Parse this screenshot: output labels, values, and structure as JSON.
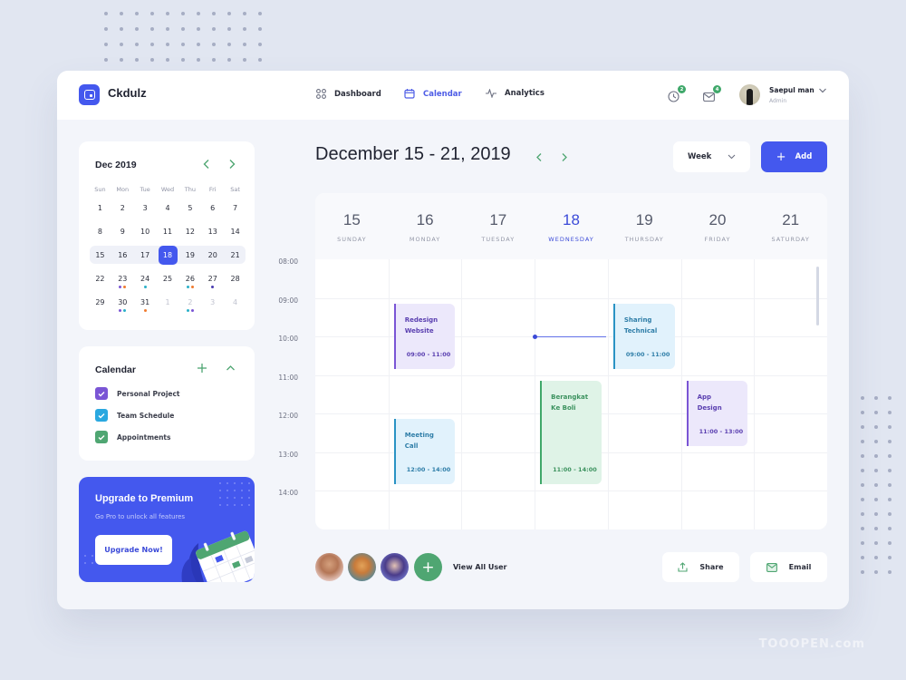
{
  "app": {
    "name": "Ckdulz"
  },
  "nav": [
    {
      "label": "Dashboard",
      "icon": "grid-icon",
      "active": false
    },
    {
      "label": "Calendar",
      "icon": "calendar-icon",
      "active": true
    },
    {
      "label": "Analytics",
      "icon": "activity-icon",
      "active": false
    }
  ],
  "header": {
    "notifications": {
      "icon": "clock-icon",
      "count": "2"
    },
    "messages": {
      "icon": "mail-icon",
      "count": "4"
    },
    "user": {
      "name": "Saepul man",
      "role": "Admin"
    }
  },
  "mini_calendar": {
    "title": "Dec 2019",
    "weekdays": [
      "Sun",
      "Mon",
      "Tue",
      "Wed",
      "Thu",
      "Fri",
      "Sat"
    ],
    "weeks": [
      [
        {
          "d": "1"
        },
        {
          "d": "2"
        },
        {
          "d": "3"
        },
        {
          "d": "4"
        },
        {
          "d": "5"
        },
        {
          "d": "6"
        },
        {
          "d": "7"
        }
      ],
      [
        {
          "d": "8"
        },
        {
          "d": "9"
        },
        {
          "d": "10"
        },
        {
          "d": "11"
        },
        {
          "d": "12"
        },
        {
          "d": "13"
        },
        {
          "d": "14"
        }
      ],
      [
        {
          "d": "15"
        },
        {
          "d": "16"
        },
        {
          "d": "17"
        },
        {
          "d": "18",
          "selected": true
        },
        {
          "d": "19"
        },
        {
          "d": "20"
        },
        {
          "d": "21"
        }
      ],
      [
        {
          "d": "22"
        },
        {
          "d": "23",
          "dots": [
            "#7a55d5",
            "#f07b2f"
          ]
        },
        {
          "d": "24",
          "dots": [
            "#2ab0c8"
          ]
        },
        {
          "d": "25"
        },
        {
          "d": "26",
          "dots": [
            "#2ab0c8",
            "#f07b2f"
          ]
        },
        {
          "d": "27",
          "dots": [
            "#4a3cb0"
          ]
        },
        {
          "d": "28"
        }
      ],
      [
        {
          "d": "29"
        },
        {
          "d": "30",
          "dots": [
            "#7a55d5",
            "#2ab0c8"
          ]
        },
        {
          "d": "31",
          "dots": [
            "#f07b2f"
          ]
        },
        {
          "d": "1",
          "muted": true
        },
        {
          "d": "2",
          "muted": true,
          "dots": [
            "#2ab0c8",
            "#7a55d5"
          ]
        },
        {
          "d": "3",
          "muted": true
        },
        {
          "d": "4",
          "muted": true
        }
      ]
    ],
    "highlight_week": 2
  },
  "calendars": {
    "title": "Calendar",
    "items": [
      {
        "label": "Personal Project",
        "color": "#7a55d5",
        "checked": true
      },
      {
        "label": "Team Schedule",
        "color": "#2aa8e0",
        "checked": true
      },
      {
        "label": "Appointments",
        "color": "#4fa672",
        "checked": true
      }
    ]
  },
  "promo": {
    "title": "Upgrade to Premium",
    "subtitle": "Go Pro to unlock all features",
    "button": "Upgrade Now!"
  },
  "week_view": {
    "title": "December 15 - 21, 2019",
    "view": "Week",
    "add_label": "Add",
    "days": [
      {
        "num": "15",
        "name": "SUNDAY"
      },
      {
        "num": "16",
        "name": "MONDAY"
      },
      {
        "num": "17",
        "name": "TUESDAY"
      },
      {
        "num": "18",
        "name": "WEDNESDAY",
        "today": true
      },
      {
        "num": "19",
        "name": "THURSDAY"
      },
      {
        "num": "20",
        "name": "FRIDAY"
      },
      {
        "num": "21",
        "name": "SATURDAY"
      }
    ],
    "times": [
      "08:00",
      "09:00",
      "10:00",
      "11:00",
      "12:00",
      "13:00",
      "14:00"
    ],
    "events": [
      {
        "title": "Redesign Website",
        "time": "09:00 - 11:00",
        "day": 1,
        "start": 9,
        "end": 10.7,
        "style": "purple"
      },
      {
        "title": "Sharing Technical",
        "time": "09:00 - 11:00",
        "day": 4,
        "start": 9,
        "end": 10.7,
        "style": "blue"
      },
      {
        "title": "Berangkat Ke Boli",
        "time": "11:00 - 14:00",
        "day": 3,
        "start": 11,
        "end": 13.7,
        "style": "green"
      },
      {
        "title": "App Design",
        "time": "11:00 - 13:00",
        "day": 5,
        "start": 11,
        "end": 12.7,
        "style": "purple"
      },
      {
        "title": "Meeting Call",
        "time": "12:00 - 14:00",
        "day": 1,
        "start": 12,
        "end": 13.7,
        "style": "blue"
      }
    ],
    "now_marker": {
      "day_from": 3,
      "day_to": 4,
      "hour": 10
    }
  },
  "footer": {
    "view_all": "View All User",
    "share": "Share",
    "email": "Email"
  },
  "watermark": "TOOOPEN.com"
}
